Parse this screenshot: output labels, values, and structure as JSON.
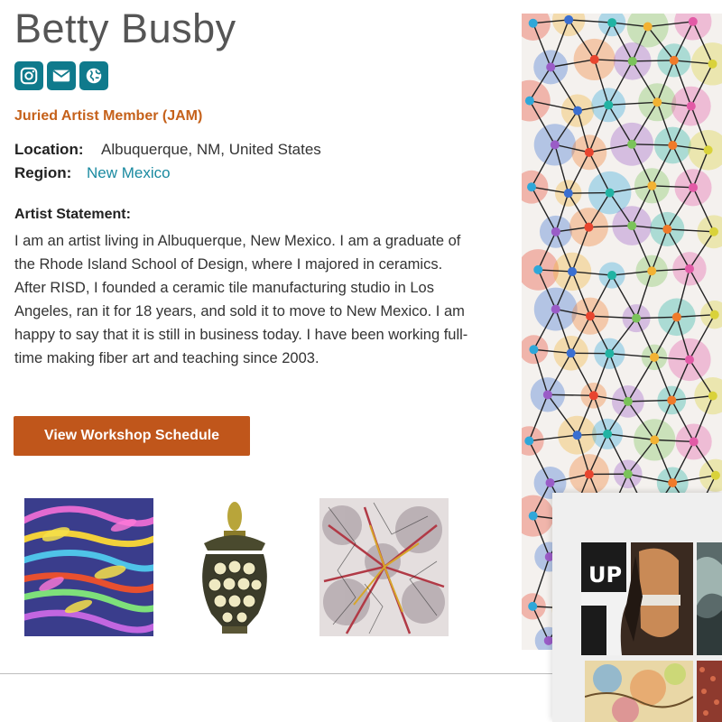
{
  "artist": {
    "name": "Betty Busby",
    "membership": "Juried Artist Member (JAM)"
  },
  "social": [
    {
      "icon": "instagram-icon",
      "label": "Instagram"
    },
    {
      "icon": "email-icon",
      "label": "Email"
    },
    {
      "icon": "globe-icon",
      "label": "Website"
    }
  ],
  "details": {
    "location_label": "Location:",
    "location_value": "Albuquerque, NM, United States",
    "region_label": "Region:",
    "region_value": "New Mexico"
  },
  "statement": {
    "heading": "Artist Statement:",
    "text": "I am an artist living in Albuquerque, New Mexico. I am a graduate of the Rhode Island School of Design, where I majored in ceramics. After RISD, I founded a ceramic tile manufacturing studio in Los Angeles, ran it for 18 years, and sold it to move to New Mexico. I am happy to say that it is still in business today. I have been working full-time making fiber art and teaching since 2003."
  },
  "cta": {
    "label": "View Workshop Schedule"
  },
  "overlay": {
    "poster_text": "UP"
  },
  "colors": {
    "teal": "#0f7a8c",
    "orange": "#c5611a",
    "button": "#c0561b",
    "link": "#1a8aa0"
  }
}
